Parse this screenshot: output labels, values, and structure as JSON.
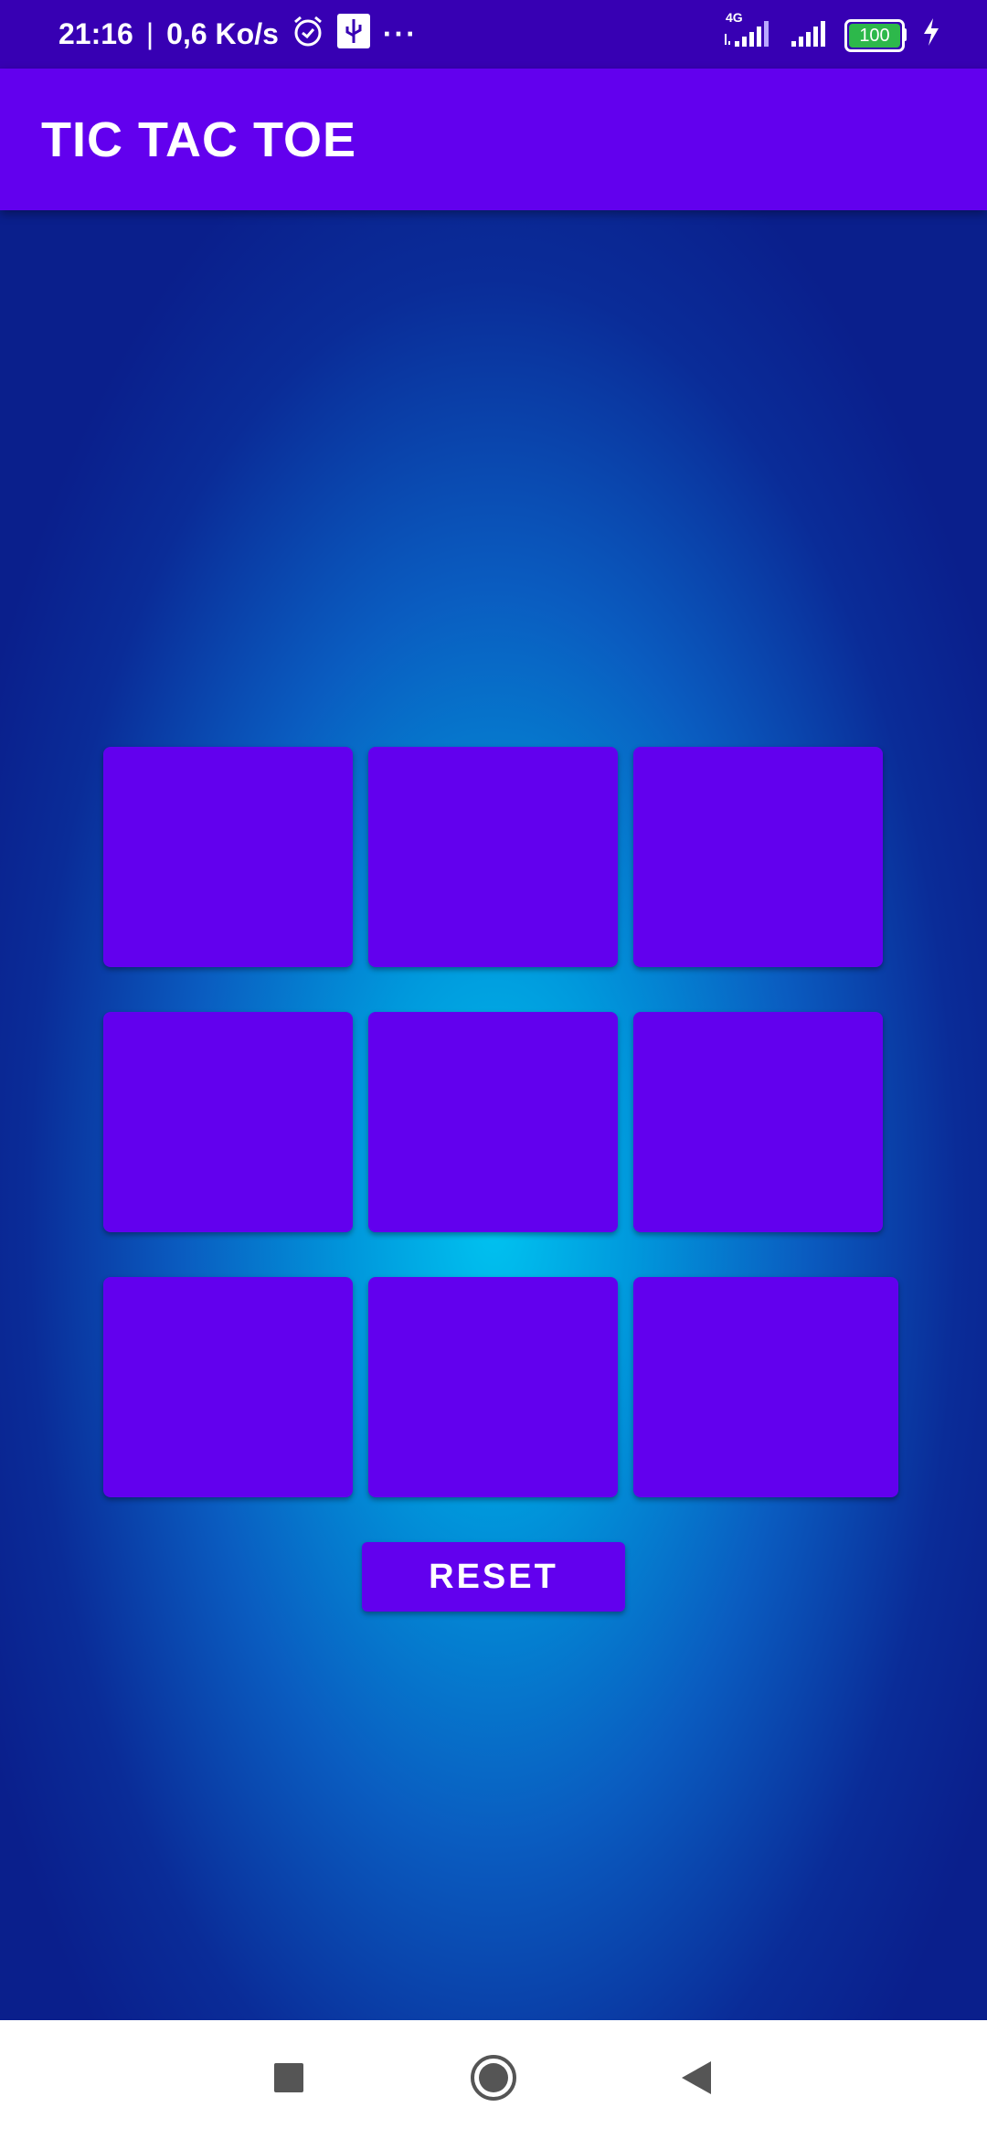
{
  "status_bar": {
    "time": "21:16",
    "separator": "|",
    "speed": "0,6 Ko/s",
    "more": "···",
    "network_type": "4G",
    "battery": "100",
    "icons": [
      "alarm-icon",
      "usb-icon",
      "signal-icon",
      "battery-icon",
      "charging-icon"
    ]
  },
  "app_bar": {
    "title": "TIC TAC TOE"
  },
  "board": {
    "cells": [
      "",
      "",
      "",
      "",
      "",
      "",
      "",
      "",
      ""
    ]
  },
  "reset_label": "RESET",
  "nav_bar": {
    "icons": [
      "recents-square-icon",
      "home-circle-icon",
      "back-triangle-icon"
    ]
  },
  "colors": {
    "primary": "#6200ee",
    "primary_dark": "#3700b3",
    "gradient_center": "#00c3f0",
    "gradient_edge": "#0a1f8c"
  }
}
